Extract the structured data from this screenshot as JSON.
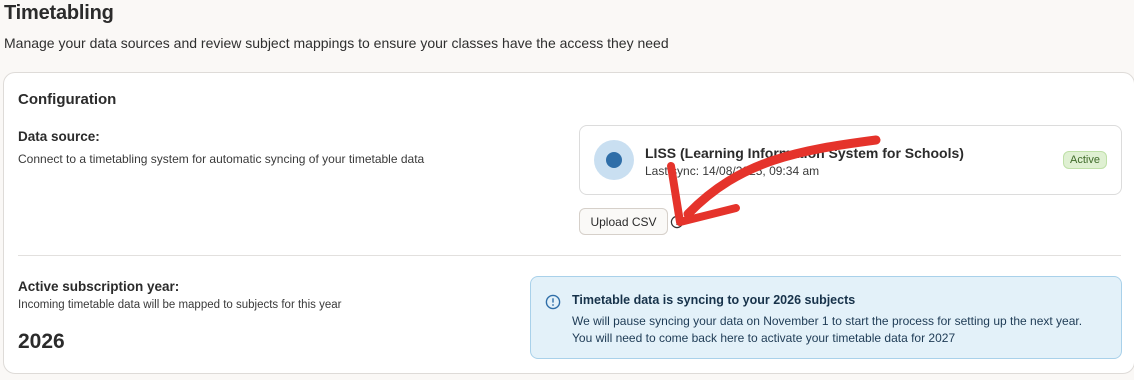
{
  "header": {
    "title": "Timetabling",
    "subtitle": "Manage your data sources and review subject mappings to ensure your classes have the access they need"
  },
  "configuration": {
    "title": "Configuration",
    "data_source": {
      "label": "Data source:",
      "help": "Connect to a timetabling system for automatic syncing of your timetable data",
      "source_name": "LISS (Learning Information System for Schools)",
      "last_sync": "Last sync: 14/08/2025, 09:34 am",
      "status": "Active",
      "upload_label": "Upload CSV",
      "upload_help_icon": "info-icon"
    },
    "subscription": {
      "label": "Active subscription year:",
      "help": "Incoming timetable data will be mapped to subjects for this year",
      "year": "2026"
    },
    "notice": {
      "icon": "info-icon",
      "title": "Timetable data is syncing to your 2026 subjects",
      "line1": "We will pause syncing your data on November 1 to start the process for setting up the next year.",
      "line2": "You will need to come back here to activate your timetable data for 2027"
    }
  },
  "annotation": {
    "icon": "red-arrow-annotation",
    "color": "#e5332b"
  },
  "colors": {
    "page_bg": "#faf8f6",
    "accent_blue": "#2f6ea8",
    "notice_bg": "#e3f1f9",
    "badge_bg": "#dff0d2"
  }
}
